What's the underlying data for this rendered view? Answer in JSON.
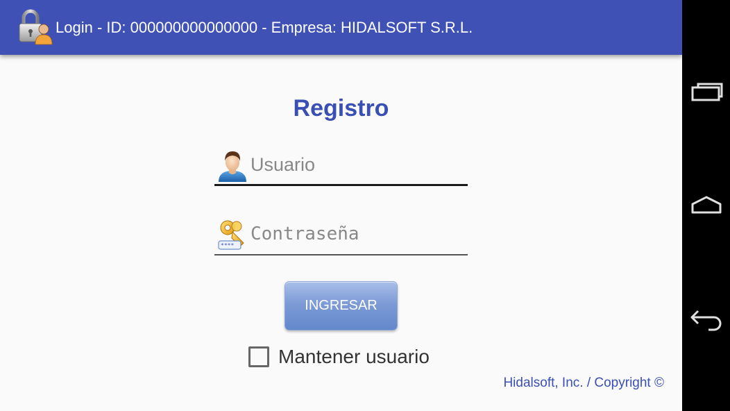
{
  "actionbar": {
    "title": "Login - ID: 000000000000000 - Empresa: HIDALSOFT S.R.L.",
    "icon": "lock-user-icon",
    "background_color": "#3f51b5"
  },
  "form": {
    "title": "Registro",
    "username": {
      "placeholder": "Usuario",
      "value": "",
      "icon": "user-avatar-icon"
    },
    "password": {
      "placeholder": "Contraseña",
      "value": "",
      "icon": "keys-password-icon"
    },
    "login_button_label": "INGRESAR",
    "remember": {
      "label": "Mantener usuario",
      "checked": false
    }
  },
  "footer": {
    "copyright": "Hidalsoft, Inc. / Copyright ©"
  },
  "navbar": {
    "items": [
      {
        "name": "recents",
        "icon": "recent-apps-icon"
      },
      {
        "name": "home",
        "icon": "home-icon"
      },
      {
        "name": "back",
        "icon": "back-icon"
      }
    ]
  },
  "colors": {
    "accent": "#3a4fb3",
    "button_gradient_top": "#a9bfe9",
    "button_gradient_bottom": "#6388cb",
    "background": "#fafafa"
  }
}
